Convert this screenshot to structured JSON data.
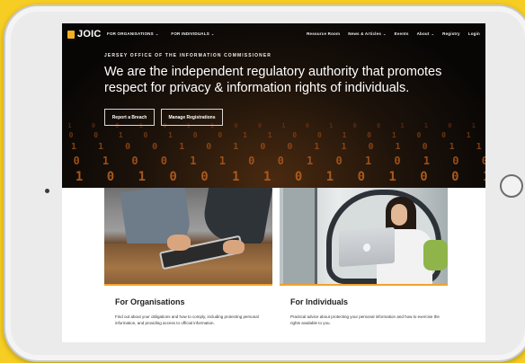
{
  "site": {
    "logo_text": "JOIC",
    "brand_color": "#f2b01e"
  },
  "nav": {
    "left_items": [
      {
        "label": "FOR ORGANISATIONS",
        "has_dropdown": true
      },
      {
        "label": "FOR INDIVIDUALS",
        "has_dropdown": true
      }
    ],
    "right_items": [
      {
        "label": "Resource Room",
        "has_dropdown": false
      },
      {
        "label": "News & Articles",
        "has_dropdown": true
      },
      {
        "label": "Events",
        "has_dropdown": false
      },
      {
        "label": "About",
        "has_dropdown": true
      },
      {
        "label": "Registry",
        "has_dropdown": false
      },
      {
        "label": "Login",
        "has_dropdown": false
      }
    ],
    "chevron_glyph": "⌄"
  },
  "hero": {
    "kicker": "JERSEY OFFICE OF THE INFORMATION COMMISSIONER",
    "headline": "We are the independent regulatory authority that promotes respect for privacy & information rights of individuals.",
    "buttons": {
      "report": "Report a Breach",
      "manage": "Manage Registrations"
    },
    "binary_rows": [
      "0 1 0 0 1 0 1 1 0 0 1 0 1 0 0 1 1 0 1 0 0 1 0 1 0 1 1 0 0 1",
      "1 0 0 1 0 1 0 0 1 1 0 0 1 0 1 0 0 1 0 1 1 0 0 1 0 1 0 0 1",
      "0 1 1 0 0 1 0 1 0 0 1 1 0 1 0 1 1 0 0 1 0 1 0 1 1 0",
      "1 0 1 0 0 1 1 0 0 1 0 1 0 1 0 0 1 0 1 1 0 0 1",
      "1 1 0 1 0 0 1 1 0 1 0 1 0 0 1 0 1 0 1"
    ]
  },
  "cards": [
    {
      "title": "For Organisations",
      "text": "Find out about your obligations and how to comply, including protecting personal information, and providing access to official information."
    },
    {
      "title": "For Individuals",
      "text": "Practical advice about protecting your personal information and how to exercise the rights available to you."
    }
  ]
}
